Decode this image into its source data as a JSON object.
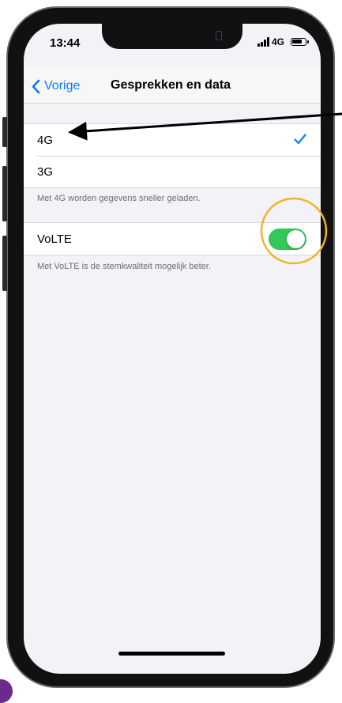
{
  "status": {
    "time": "13:44",
    "network": "4G"
  },
  "nav": {
    "back_label": "Vorige",
    "title": "Gesprekken en data"
  },
  "voice_data": {
    "options": [
      "4G",
      "3G"
    ],
    "selected": "4G",
    "footer": "Met 4G worden gegevens sneller geladen."
  },
  "volte": {
    "label": "VoLTE",
    "enabled": true,
    "footer": "Met VoLTE is de stemkwaliteit mogelijk beter."
  },
  "colors": {
    "accent": "#0a7aff",
    "toggle_on": "#34c759",
    "highlight_circle": "#f0b428",
    "annotation_arrow": "#000000"
  },
  "icons": [
    "chevron-left-icon",
    "checkmark-icon",
    "signal-icon",
    "battery-icon"
  ]
}
